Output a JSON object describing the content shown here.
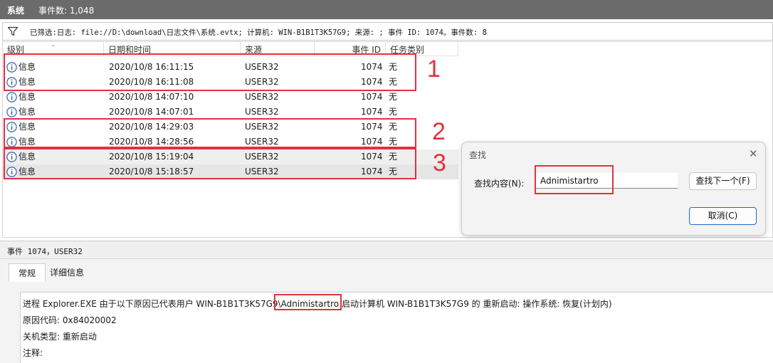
{
  "titlebar": {
    "name": "系统",
    "count": "事件数: 1,048"
  },
  "filter": {
    "text": "已筛选:日志: file://D:\\download\\日志文件\\系统.evtx; 计算机: WIN-B1B1T3K57G9; 来源: ; 事件 ID: 1074。事件数: 8"
  },
  "columns": {
    "level": "级别",
    "datetime": "日期和时间",
    "source": "来源",
    "event_id": "事件 ID",
    "task": "任务类别"
  },
  "rows": [
    {
      "level": "信息",
      "datetime": "2020/10/8 16:11:15",
      "source": "USER32",
      "event_id": "1074",
      "task": "无"
    },
    {
      "level": "信息",
      "datetime": "2020/10/8 16:11:08",
      "source": "USER32",
      "event_id": "1074",
      "task": "无"
    },
    {
      "level": "信息",
      "datetime": "2020/10/8 14:07:10",
      "source": "USER32",
      "event_id": "1074",
      "task": "无"
    },
    {
      "level": "信息",
      "datetime": "2020/10/8 14:07:01",
      "source": "USER32",
      "event_id": "1074",
      "task": "无"
    },
    {
      "level": "信息",
      "datetime": "2020/10/8 14:29:03",
      "source": "USER32",
      "event_id": "1074",
      "task": "无"
    },
    {
      "level": "信息",
      "datetime": "2020/10/8 14:28:56",
      "source": "USER32",
      "event_id": "1074",
      "task": "无"
    },
    {
      "level": "信息",
      "datetime": "2020/10/8 15:19:04",
      "source": "USER32",
      "event_id": "1074",
      "task": "无"
    },
    {
      "level": "信息",
      "datetime": "2020/10/8 15:18:57",
      "source": "USER32",
      "event_id": "1074",
      "task": "无"
    }
  ],
  "annotations": {
    "n1": "1",
    "n2": "2",
    "n3": "3",
    "color": "#e0323f"
  },
  "find_dialog": {
    "title": "查找",
    "label": "查找内容(N):",
    "value": "Adnimistartro",
    "next_button": "查找下一个(F)",
    "cancel_button": "取消(C)"
  },
  "details": {
    "header": "事件 1074，USER32",
    "tabs": [
      "常规",
      "详细信息"
    ],
    "line1": "进程 Explorer.EXE 由于以下原因已代表用户 WIN-B1B1T3K57G9\\Adnimistartro 启动计算机 WIN-B1B1T3K57G9 的 重新启动: 操作系统: 恢复(计划内)",
    "line2": "原因代码: 0x84020002",
    "line3": "关机类型: 重新启动",
    "line4": "注释:"
  },
  "icons": {
    "filter": "filter-icon",
    "info": "info-icon",
    "close": "close-icon"
  }
}
